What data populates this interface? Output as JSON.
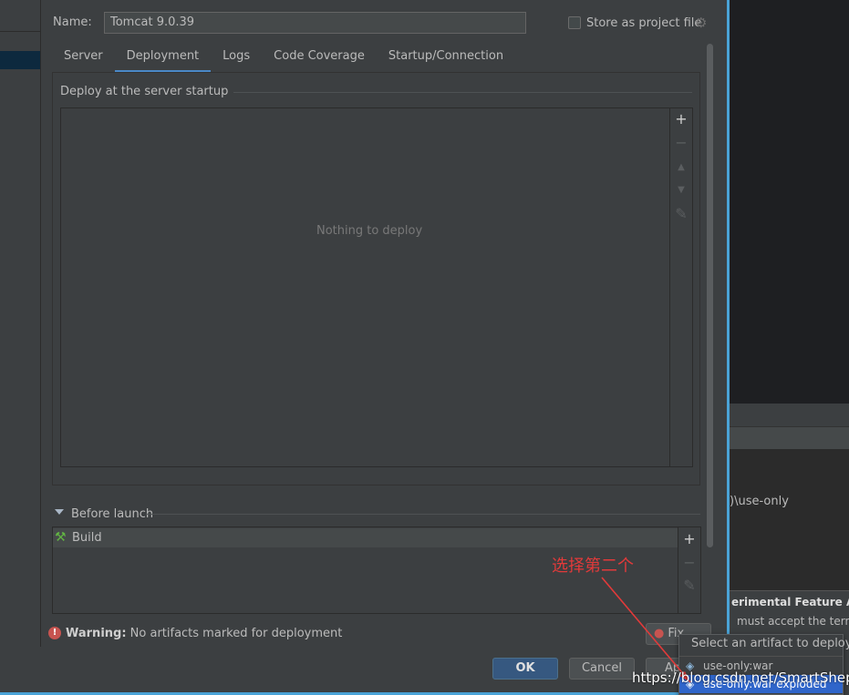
{
  "dialog": {
    "name_label": "Name:",
    "name_value": "Tomcat 9.0.39",
    "store_label": "Store as project file",
    "tabs": [
      {
        "label": "Server"
      },
      {
        "label": "Deployment"
      },
      {
        "label": "Logs"
      },
      {
        "label": "Code Coverage"
      },
      {
        "label": "Startup/Connection"
      }
    ],
    "active_tab": "Deployment"
  },
  "deployment": {
    "group_title": "Deploy at the server startup",
    "empty_text": "Nothing to deploy",
    "tools": {
      "add": "+",
      "remove": "−",
      "up": "▲",
      "down": "▼",
      "edit": "✎"
    }
  },
  "before_launch": {
    "label": "Before launch",
    "items": [
      {
        "label": "Build",
        "icon": "hammer-icon"
      }
    ],
    "tools": {
      "add": "+",
      "remove": "−",
      "edit": "✎"
    }
  },
  "warning": {
    "bold": "Warning:",
    "text": " No artifacts marked for deployment",
    "fix_label": "Fix"
  },
  "buttons": {
    "ok": "OK",
    "cancel": "Cancel",
    "apply": "Ap"
  },
  "popup": {
    "title": "Select an artifact to deploy",
    "items": [
      {
        "label": "use-only:war"
      },
      {
        "label": "use-only:war exploded"
      }
    ]
  },
  "background": {
    "console_line": ")\\use-only",
    "notice_title": "erimental Feature Al",
    "notice_text": "must accept the term"
  },
  "annotation": {
    "text": "选择第二个"
  },
  "watermark": {
    "text": "https://blog.csdn.net/SmartShepi"
  },
  "colors": {
    "accent": "#4a88c7",
    "selection": "#2f65ca",
    "annotation": "#e23a3a",
    "ok_button": "#365880"
  }
}
